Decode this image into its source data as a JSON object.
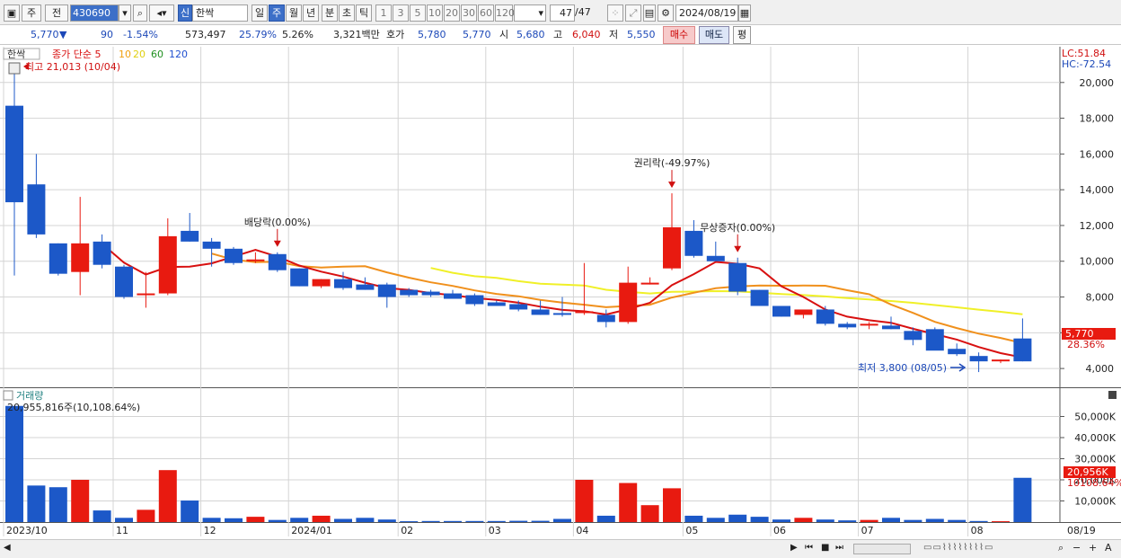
{
  "toolbar": {
    "period_selector": "주",
    "prev_label": "전",
    "stock_code": "430690",
    "market_badge": "신",
    "stock_name": "한싹",
    "interval_tabs": [
      "일",
      "주",
      "월",
      "년",
      "분",
      "초",
      "틱"
    ],
    "active_interval": "주",
    "minute_options": [
      "1",
      "3",
      "5",
      "10",
      "20",
      "30",
      "60",
      "120"
    ],
    "bar_count": "47",
    "bar_total": "/47",
    "date": "2024/08/19"
  },
  "quote": {
    "price": "5,770",
    "change_arrow": "▼",
    "change": "90",
    "change_pct": "-1.54%",
    "volume": "573,497",
    "turnover_pct": "25.79%",
    "ratio_pct": "5.26%",
    "amount": "3,321백만",
    "bid_label": "호가",
    "bid": "5,780",
    "ask": "5,770",
    "open_label": "시",
    "open": "5,680",
    "high_label": "고",
    "high": "6,040",
    "low_label": "저",
    "low": "5,550",
    "buy_label": "매수",
    "sell_label": "매도",
    "eval_label": "평"
  },
  "legend": {
    "name": "한싹",
    "ma_title": "종가 단순 5",
    "ma_periods": [
      "10",
      "20",
      "60",
      "120"
    ],
    "ma_colors": {
      "5": "#d81010",
      "10": "#f0a010",
      "20": "#f0e020",
      "60": "#209020",
      "120": "#2050d0"
    },
    "max_label": "최고 21,013 (10/04)",
    "min_label": "최저 3,800 (08/05)",
    "lc_label": "LC:51.84",
    "hc_label": "HC:-72.54"
  },
  "annotations": [
    {
      "label": "배당락(0.00%)",
      "bar_index": 12
    },
    {
      "label": "권리락(-49.97%)",
      "bar_index": 30
    },
    {
      "label": "무상증자(0.00%)",
      "bar_index": 33
    }
  ],
  "volume_panel": {
    "title": "거래량",
    "summary": "20,955,816주(10,108.64%)",
    "last_volume_label": "20,956K",
    "last_pct_label": "10108.64%"
  },
  "price_tag": {
    "price": "5,770",
    "change_pct": "28.36%"
  },
  "x_axis_labels": [
    {
      "label": "2023/10",
      "bar_index": 0
    },
    {
      "label": "11",
      "bar_index": 5
    },
    {
      "label": "12",
      "bar_index": 9
    },
    {
      "label": "2024/01",
      "bar_index": 13
    },
    {
      "label": "02",
      "bar_index": 18
    },
    {
      "label": "03",
      "bar_index": 22
    },
    {
      "label": "04",
      "bar_index": 26
    },
    {
      "label": "05",
      "bar_index": 31
    },
    {
      "label": "06",
      "bar_index": 35
    },
    {
      "label": "07",
      "bar_index": 39
    },
    {
      "label": "08",
      "bar_index": 44
    }
  ],
  "x_axis_end_label": "08/19",
  "chart_data": {
    "type": "candlestick",
    "price_ylim": [
      3000,
      22000
    ],
    "price_ticks": [
      4000,
      6000,
      8000,
      10000,
      12000,
      14000,
      16000,
      18000,
      20000
    ],
    "price_tick_labels": [
      "4,000",
      "6,000",
      "8,000",
      "10,000",
      "12,000",
      "14,000",
      "16,000",
      "18,000",
      "20,000"
    ],
    "volume_ylim": [
      0,
      60000
    ],
    "volume_ticks": [
      10000,
      20000,
      30000,
      40000,
      50000
    ],
    "volume_tick_labels": [
      "10,000K",
      "20,000K",
      "30,000K",
      "40,000K",
      "50,000K"
    ],
    "ohlc": [
      [
        18700,
        21013,
        9200,
        13300
      ],
      [
        14300,
        16000,
        11300,
        11500
      ],
      [
        11000,
        11000,
        9200,
        9300
      ],
      [
        9400,
        13600,
        8100,
        11000
      ],
      [
        11100,
        11500,
        9600,
        9800
      ],
      [
        9700,
        9800,
        7900,
        8000
      ],
      [
        8200,
        9400,
        7400,
        8200
      ],
      [
        8200,
        12400,
        8100,
        11400
      ],
      [
        11700,
        12700,
        11100,
        11100
      ],
      [
        11100,
        11300,
        9700,
        10700
      ],
      [
        10700,
        10800,
        9800,
        9900
      ],
      [
        10000,
        10500,
        9900,
        10100
      ],
      [
        10400,
        10500,
        9400,
        9500
      ],
      [
        9600,
        9600,
        8600,
        8600
      ],
      [
        8600,
        9000,
        8500,
        9000
      ],
      [
        9000,
        9400,
        8400,
        8500
      ],
      [
        8700,
        9100,
        8400,
        8400
      ],
      [
        8700,
        8800,
        7400,
        8000
      ],
      [
        8400,
        8500,
        8000,
        8100
      ],
      [
        8300,
        8400,
        8000,
        8100
      ],
      [
        8200,
        8400,
        7900,
        7900
      ],
      [
        8100,
        8200,
        7500,
        7600
      ],
      [
        7700,
        7800,
        7500,
        7500
      ],
      [
        7600,
        7800,
        7200,
        7300
      ],
      [
        7300,
        7800,
        7000,
        7000
      ],
      [
        7100,
        8000,
        6900,
        7000
      ],
      [
        7100,
        9900,
        7000,
        7200
      ],
      [
        7000,
        7300,
        6300,
        6600
      ],
      [
        6600,
        9700,
        6500,
        8800
      ],
      [
        8800,
        9100,
        8700,
        8800
      ],
      [
        9600,
        13800,
        9500,
        11900
      ],
      [
        11700,
        12300,
        10200,
        10300
      ],
      [
        10300,
        11100,
        10000,
        10000
      ],
      [
        9900,
        10200,
        8100,
        8300
      ],
      [
        8400,
        8400,
        7500,
        7500
      ],
      [
        7500,
        7500,
        6900,
        6900
      ],
      [
        7000,
        7200,
        6800,
        7300
      ],
      [
        7300,
        7500,
        6400,
        6500
      ],
      [
        6500,
        6600,
        6200,
        6300
      ],
      [
        6500,
        6600,
        6200,
        6500
      ],
      [
        6400,
        6900,
        6200,
        6200
      ],
      [
        6100,
        6300,
        5300,
        5600
      ],
      [
        6200,
        6300,
        5100,
        5000
      ],
      [
        5100,
        5400,
        4700,
        4800
      ],
      [
        4700,
        4900,
        3800,
        4400
      ],
      [
        4400,
        4500,
        4300,
        4500
      ],
      [
        5680,
        6800,
        4400,
        4400
      ]
    ],
    "volume_thousands": [
      55000,
      17300,
      16500,
      20000,
      5500,
      2000,
      5800,
      24600,
      10200,
      2000,
      1800,
      2500,
      1000,
      2000,
      3000,
      1500,
      2000,
      1200,
      400,
      500,
      500,
      500,
      500,
      600,
      600,
      1500,
      20000,
      3000,
      18500,
      8000,
      16000,
      3000,
      2000,
      3500,
      2500,
      1200,
      2000,
      1200,
      800,
      1000,
      2000,
      1000,
      1500,
      1000,
      500,
      400,
      20956
    ],
    "up_color": "#e81a10",
    "down_color": "#1c58c8",
    "ma5_color": "#d81010",
    "ma10_color": "#f0901c",
    "ma20_color": "#f0f028",
    "ma20_start_index": 19
  }
}
